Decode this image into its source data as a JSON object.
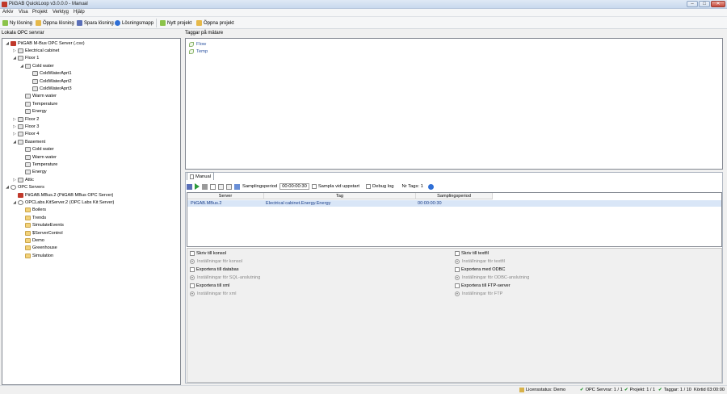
{
  "window": {
    "title": "PiiGAB QuickLoop v3.0.0.0 - Manual"
  },
  "menu": [
    "Arkiv",
    "Visa",
    "Projekt",
    "Verktyg",
    "Hjälp"
  ],
  "toolbar": {
    "new_solution": "Ny lösning",
    "open_solution": "Öppna lösning",
    "save_solution": "Spara lösning",
    "solution_folder": "Lösningsmapp",
    "new_project": "Nytt projekt",
    "open_project": "Öppna projekt"
  },
  "left_panel": {
    "title": "Lokala OPC servrar"
  },
  "tree": [
    {
      "label": "PiiGAB M-Bus OPC Server (.csv)",
      "exp": "◢",
      "icon": "server"
    },
    {
      "label": "Electrical cabinet",
      "exp": "▷",
      "icon": "node"
    },
    {
      "label": "Floor 1",
      "exp": "◢",
      "icon": "node"
    },
    {
      "label": "Cold water",
      "exp": "◢",
      "icon": "node"
    },
    {
      "label": "ColdWaterAprt1",
      "exp": "",
      "icon": "node"
    },
    {
      "label": "ColdWaterAprt2",
      "exp": "",
      "icon": "node"
    },
    {
      "label": "ColdWaterAprt3",
      "exp": "",
      "icon": "node"
    },
    {
      "label": "Warm water",
      "exp": "",
      "icon": "node"
    },
    {
      "label": "Temperature",
      "exp": "",
      "icon": "node"
    },
    {
      "label": "Energy",
      "exp": "",
      "icon": "node"
    },
    {
      "label": "Floor 2",
      "exp": "▷",
      "icon": "node"
    },
    {
      "label": "Floor 3",
      "exp": "▷",
      "icon": "node"
    },
    {
      "label": "Floor 4",
      "exp": "▷",
      "icon": "node"
    },
    {
      "label": "Basement",
      "exp": "◢",
      "icon": "node"
    },
    {
      "label": "Cold water",
      "exp": "",
      "icon": "node"
    },
    {
      "label": "Warm water",
      "exp": "",
      "icon": "node"
    },
    {
      "label": "Temperature",
      "exp": "",
      "icon": "node"
    },
    {
      "label": "Energy",
      "exp": "",
      "icon": "node"
    },
    {
      "label": "Attic",
      "exp": "▷",
      "icon": "node"
    },
    {
      "label": "OPC Servers",
      "exp": "◢",
      "icon": "ring"
    },
    {
      "label": "PiiGAB.MBus.2 (PiiGAB MBus OPC Server)",
      "exp": "",
      "icon": "server"
    },
    {
      "label": "OPCLabs.KitServer.2 (OPC Labs Kit Server)",
      "exp": "◢",
      "icon": "ring"
    },
    {
      "label": "Boilers",
      "exp": "",
      "icon": "folder"
    },
    {
      "label": "Trends",
      "exp": "",
      "icon": "folder"
    },
    {
      "label": "SimulateEvents",
      "exp": "",
      "icon": "folder"
    },
    {
      "label": "$ServerControl",
      "exp": "",
      "icon": "folder"
    },
    {
      "label": "Demo",
      "exp": "",
      "icon": "folder"
    },
    {
      "label": "Greenhouse",
      "exp": "",
      "icon": "folder"
    },
    {
      "label": "Simulation",
      "exp": "",
      "icon": "folder"
    }
  ],
  "tags_panel": {
    "title": "Taggar på mätare",
    "items": [
      "Flow",
      "Temp"
    ]
  },
  "manual": {
    "tab_label": "Manual",
    "sampling_label": "Samplingsperiod",
    "sampling_value": "00:00:00:30",
    "sample_on_start": "Sampla vid uppstart",
    "debug_log": "Debug log",
    "nr_tags": "Nr Tags: 1",
    "columns": [
      "Server",
      "Tag",
      "Samplingsperiod"
    ],
    "rows": [
      {
        "server": "PiiGAB.MBus.2",
        "tag": "Electrical cabinet.Energy.Energy",
        "period": "00:00:00:30"
      }
    ],
    "options_left": [
      {
        "label": "Skriv till konsol",
        "kind": "check"
      },
      {
        "label": "Inställningar för konsol",
        "kind": "sub"
      },
      {
        "label": "Exportera till databas",
        "kind": "check"
      },
      {
        "label": "Inställningar för SQL-anslutning",
        "kind": "sub"
      },
      {
        "label": "Exportera till xml",
        "kind": "check"
      },
      {
        "label": "Inställningar för xml",
        "kind": "sub"
      }
    ],
    "options_right": [
      {
        "label": "Skriv till textfil",
        "kind": "check"
      },
      {
        "label": "Inställningar för textfil",
        "kind": "sub"
      },
      {
        "label": "Exportera med ODBC",
        "kind": "check"
      },
      {
        "label": "Inställningar för ODBC-anslutning",
        "kind": "sub"
      },
      {
        "label": "Exportera till FTP-server",
        "kind": "check"
      },
      {
        "label": "Inställningar för FTP",
        "kind": "sub"
      }
    ]
  },
  "status": {
    "license": "Licensstatus: Demo",
    "opc_servers": "OPC Servrar: 1 / 1",
    "projects": "Projekt: 1 / 1",
    "tags": "Taggar: 1 / 10",
    "runtime": "Körtid 03:00:00"
  }
}
